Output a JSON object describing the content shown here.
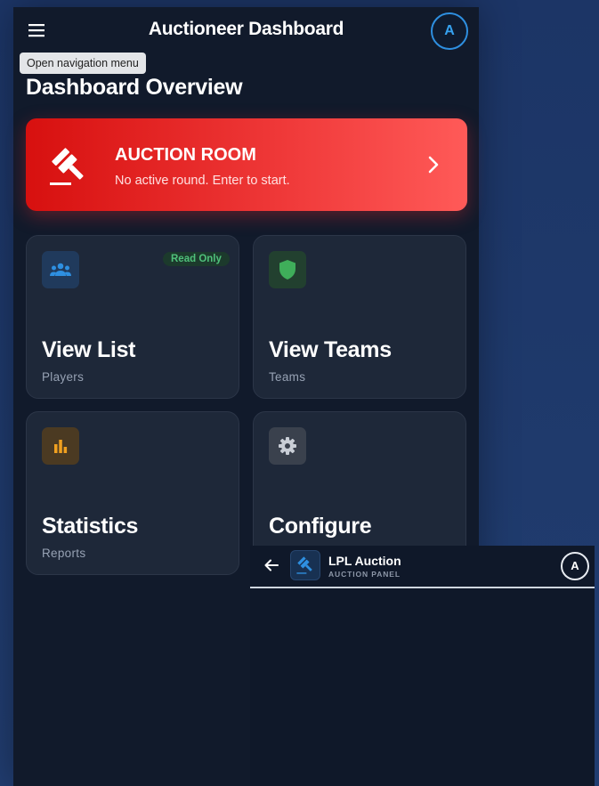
{
  "header": {
    "title": "Auctioneer Dashboard",
    "menu_icon": "hamburger-menu-icon",
    "avatar_initial": "A",
    "tooltip": "Open navigation menu"
  },
  "page_title": "Dashboard Overview",
  "hero": {
    "title": "AUCTION ROOM",
    "subtitle": "No active round. Enter to start.",
    "icon": "gavel-icon",
    "chevron_icon": "chevron-right-icon"
  },
  "cards": [
    {
      "title": "View List",
      "subtitle": "Players",
      "icon": "group-icon",
      "badge": "Read Only",
      "color": "#2e8fe0"
    },
    {
      "title": "View Teams",
      "subtitle": "Teams",
      "icon": "shield-icon",
      "color": "#3fae5a"
    },
    {
      "title": "Statistics",
      "subtitle": "Reports",
      "icon": "bar-chart-icon",
      "color": "#f0a020"
    },
    {
      "title": "Configure",
      "subtitle": "",
      "icon": "gear-icon",
      "color": "#c9ced6"
    }
  ],
  "panel": {
    "title": "LPL Auction",
    "subtitle": "AUCTION PANEL",
    "back_icon": "arrow-left-icon",
    "logo_icon": "gavel-icon",
    "avatar_initial": "A"
  },
  "colors": {
    "background": "#1f3a6c",
    "surface": "#111a2b",
    "card": "#1e2839",
    "accent_red": "#e52424",
    "accent_blue": "#2e8fe0"
  }
}
